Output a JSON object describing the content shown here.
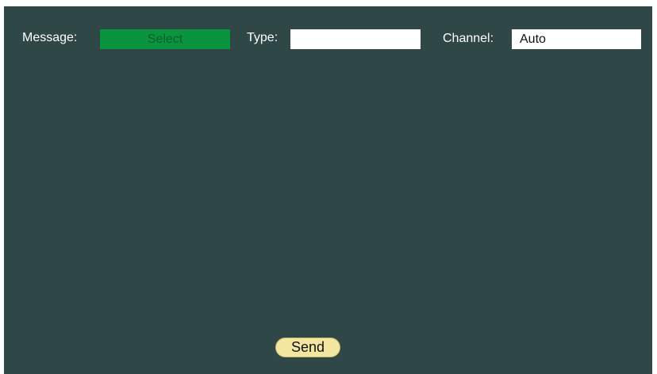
{
  "form": {
    "message_label": "Message:",
    "message_select_label": "Select",
    "type_label": "Type:",
    "type_value": "",
    "channel_label": "Channel:",
    "channel_value": "Auto"
  },
  "actions": {
    "send_label": "Send"
  },
  "colors": {
    "panel_background": "#2f4747",
    "select_button": "#0a9440",
    "send_button": "#f3e6a0"
  }
}
